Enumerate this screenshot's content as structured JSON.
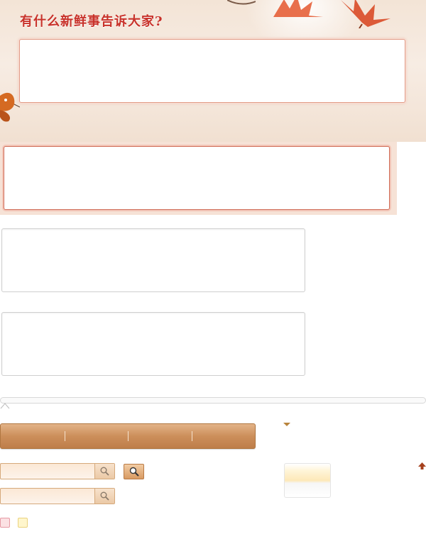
{
  "hero": {
    "title": "有什么新鲜事告诉大家?"
  },
  "composer": {
    "placeholder": ""
  },
  "pink_textarea": {
    "placeholder": ""
  },
  "textarea_3": {
    "placeholder": ""
  },
  "textarea_4": {
    "placeholder": ""
  },
  "tab_bar": {
    "tabs": [
      {
        "label": ""
      },
      {
        "label": ""
      },
      {
        "label": ""
      },
      {
        "label": ""
      }
    ]
  },
  "search_1": {
    "placeholder": "",
    "icon": "search-icon"
  },
  "search_2": {
    "placeholder": "",
    "icon": "search-icon"
  },
  "colors": {
    "accent_red": "#c8322a",
    "tab_brown": "#cc8f5b",
    "border_pink": "#cf6a55"
  }
}
